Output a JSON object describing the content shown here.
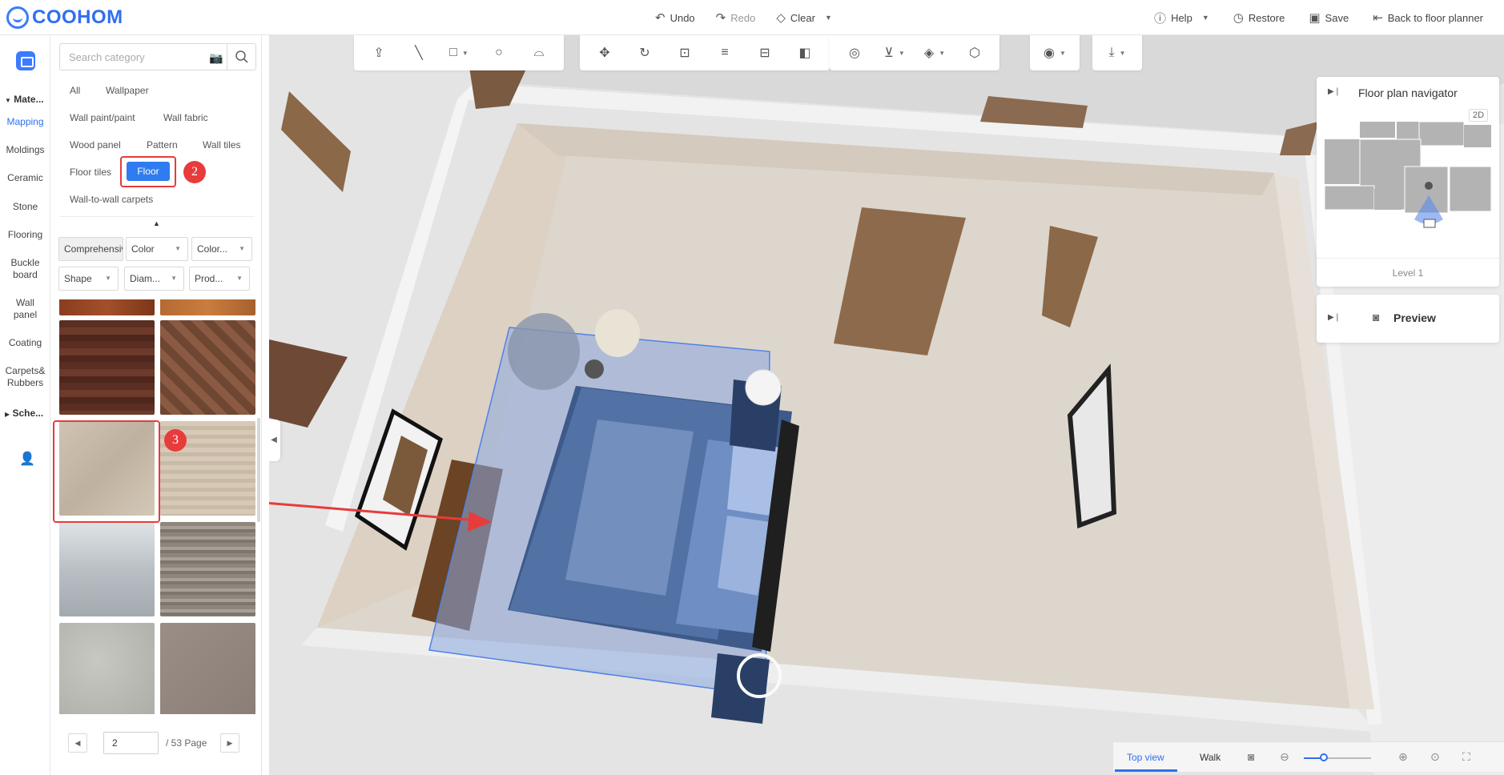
{
  "app": {
    "brand": "COOHOM"
  },
  "topbar": {
    "undo": "Undo",
    "redo": "Redo",
    "clear": "Clear",
    "help": "Help",
    "restore": "Restore",
    "save": "Save",
    "back": "Back to floor planner"
  },
  "rail": {
    "sections": [
      {
        "label": "Mate...",
        "arrow": "▼"
      },
      {
        "label": "Sche...",
        "arrow": "▶"
      }
    ],
    "items": [
      {
        "label": "Mapping",
        "active": true
      },
      {
        "label": "Moldings"
      },
      {
        "label": "Ceramic"
      },
      {
        "label": "Stone"
      },
      {
        "label": "Flooring"
      },
      {
        "label": "Buckle board"
      },
      {
        "label": "Wall panel"
      },
      {
        "label": "Coating"
      },
      {
        "label": "Carpets& Rubbers"
      }
    ]
  },
  "panel": {
    "search_placeholder": "Search category",
    "categories": [
      "All",
      "Wallpaper",
      "Wall paint/paint",
      "Wall fabric",
      "Wood panel",
      "Pattern",
      "Wall tiles",
      "Floor tiles",
      "Floor",
      "Wall-to-wall carpets"
    ],
    "selected_category": "Floor",
    "filters": [
      {
        "label": "Comprehensive",
        "active": true
      },
      {
        "label": "Color"
      },
      {
        "label": "Color..."
      },
      {
        "label": "Shape"
      },
      {
        "label": "Diam..."
      },
      {
        "label": "Prod..."
      }
    ],
    "pagination": {
      "current": "2",
      "total_text": "/ 53 Page"
    }
  },
  "annotations": {
    "step2": "2",
    "step3": "3"
  },
  "navigator": {
    "title": "Floor plan navigator",
    "mode": "2D",
    "level": "Level 1"
  },
  "preview": {
    "label": "Preview"
  },
  "bottom": {
    "top_view": "Top view",
    "walk": "Walk",
    "zoom_level": 0.3
  },
  "colors": {
    "accent": "#2f7bf0",
    "annotation": "#e83b3b",
    "selection": "#7aa1e8"
  }
}
